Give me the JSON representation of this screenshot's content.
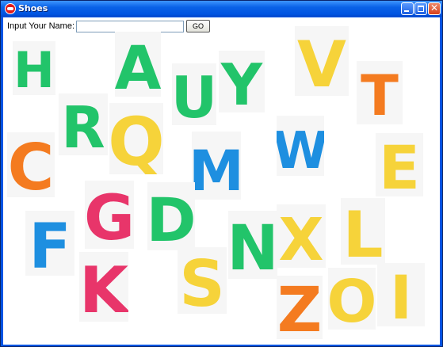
{
  "window": {
    "title": "Shoes",
    "minimize_icon": "minimize-icon",
    "maximize_icon": "maximize-icon",
    "close_icon": "close-icon"
  },
  "form": {
    "label": "Input Your Name:",
    "input_value": "",
    "button_label": "GO"
  },
  "letters": [
    {
      "char": "H",
      "color": "#22c46a"
    },
    {
      "char": "A",
      "color": "#22c46a"
    },
    {
      "char": "U",
      "color": "#22c46a"
    },
    {
      "char": "Y",
      "color": "#22c46a"
    },
    {
      "char": "V",
      "color": "#f6d33a"
    },
    {
      "char": "T",
      "color": "#f47b20"
    },
    {
      "char": "R",
      "color": "#22c46a"
    },
    {
      "char": "Q",
      "color": "#f6d33a"
    },
    {
      "char": "C",
      "color": "#f47b20"
    },
    {
      "char": "M",
      "color": "#1e8fe0"
    },
    {
      "char": "W",
      "color": "#1e8fe0"
    },
    {
      "char": "E",
      "color": "#f6d33a"
    },
    {
      "char": "G",
      "color": "#e8356a"
    },
    {
      "char": "D",
      "color": "#22c46a"
    },
    {
      "char": "F",
      "color": "#1e8fe0"
    },
    {
      "char": "N",
      "color": "#22c46a"
    },
    {
      "char": "X",
      "color": "#f6d33a"
    },
    {
      "char": "L",
      "color": "#f6d33a"
    },
    {
      "char": "K",
      "color": "#e8356a"
    },
    {
      "char": "S",
      "color": "#f6d33a"
    },
    {
      "char": "Z",
      "color": "#f47b20"
    },
    {
      "char": "O",
      "color": "#f6d33a"
    },
    {
      "char": "I",
      "color": "#f6d33a"
    }
  ]
}
